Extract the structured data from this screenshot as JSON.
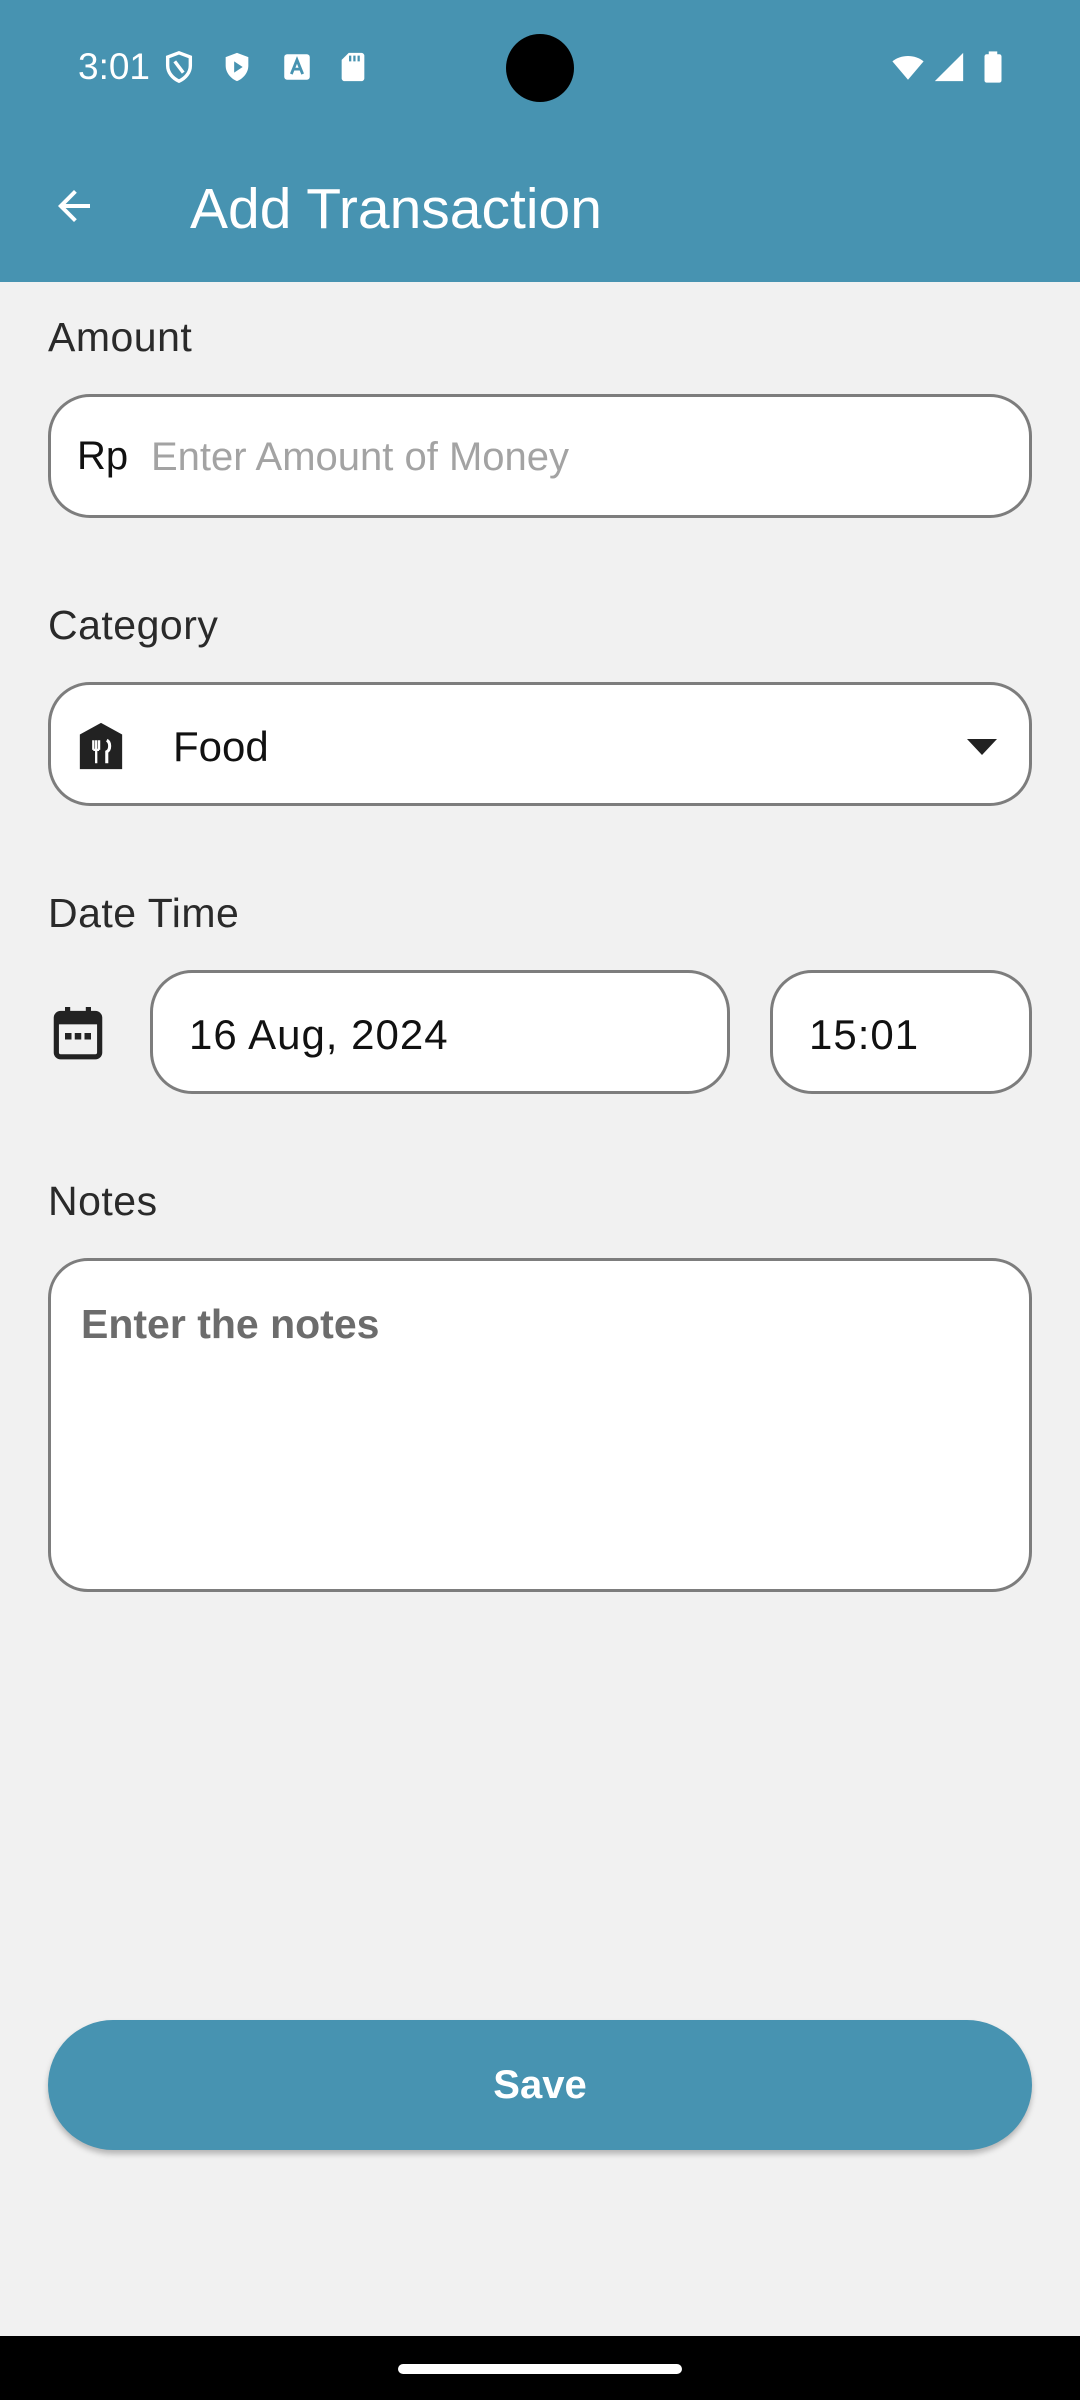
{
  "status_bar": {
    "time": "3:01",
    "left_icons": [
      "vpn-shield-icon",
      "play-protect-icon",
      "accessibility-text-icon",
      "sd-card-icon"
    ],
    "right_icons": [
      "wifi-icon",
      "cellular-signal-icon",
      "battery-icon"
    ]
  },
  "header": {
    "back_icon": "arrow-back-icon",
    "title": "Add Transaction"
  },
  "form": {
    "amount": {
      "label": "Amount",
      "prefix": "Rp",
      "value": "",
      "placeholder": "Enter Amount of Money"
    },
    "category": {
      "label": "Category",
      "icon": "restaurant-store-icon",
      "selected": "Food"
    },
    "datetime": {
      "label": "Date Time",
      "date": "16 Aug, 2024",
      "time": "15:01"
    },
    "notes": {
      "label": "Notes",
      "value": "",
      "placeholder": "Enter the notes"
    }
  },
  "save_button": {
    "label": "Save"
  },
  "colors": {
    "accent": "#4793b1",
    "background": "#f1f1f1",
    "border": "#7d7d7d"
  }
}
